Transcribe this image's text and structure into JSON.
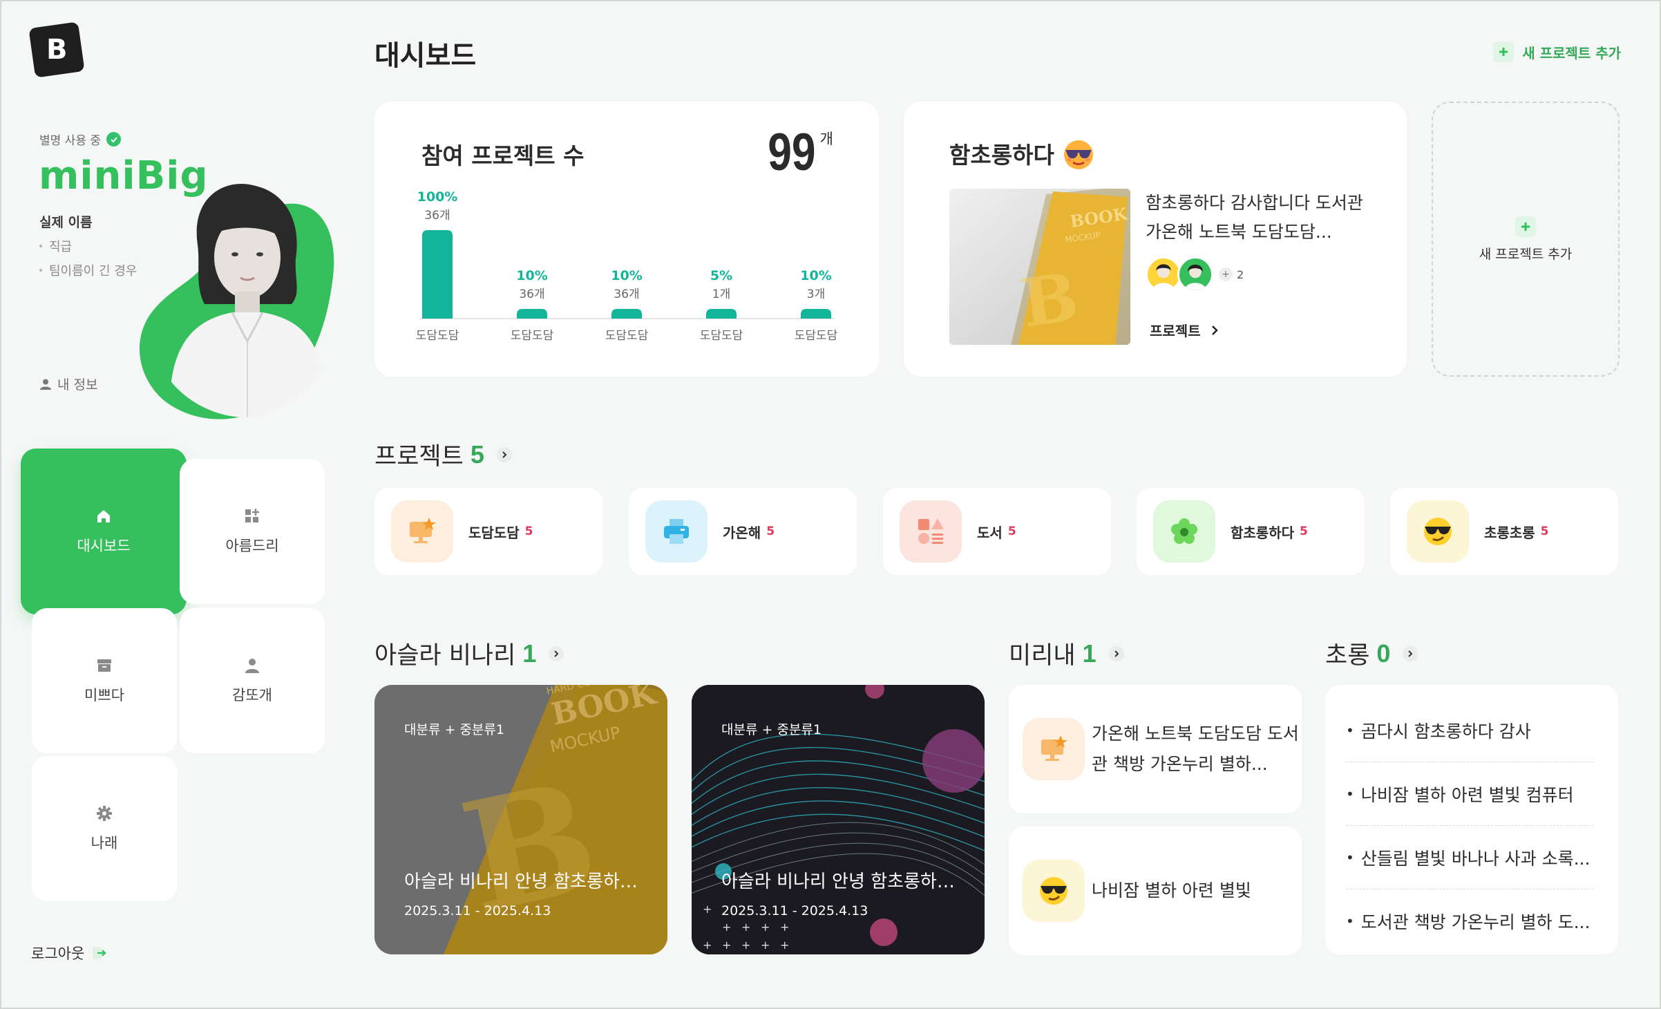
{
  "sidebar": {
    "nick_status": "별명 사용 중",
    "nickname": "miniBig",
    "realname_label": "실제 이름",
    "sub_items": [
      "직급",
      "팀이름이 긴 경우"
    ],
    "my_info": "내 정보",
    "nav": [
      {
        "label": "대시보드",
        "icon": "home-icon",
        "active": true
      },
      {
        "label": "아름드리",
        "icon": "apps-plus-icon",
        "active": false
      },
      {
        "label": "미쁘다",
        "icon": "archive-icon",
        "active": false
      },
      {
        "label": "감또개",
        "icon": "user-icon",
        "active": false
      },
      {
        "label": "나래",
        "icon": "gear-icon",
        "active": false
      }
    ],
    "logout": "로그아웃"
  },
  "header": {
    "title": "대시보드",
    "add_project": "새 프로젝트 추가"
  },
  "summary": {
    "title": "참여 프로젝트 수",
    "total": "99",
    "unit": "개"
  },
  "chart_data": {
    "type": "bar",
    "categories": [
      "도담도담",
      "도담도담",
      "도담도담",
      "도담도담",
      "도담도담"
    ],
    "values": [
      100,
      10,
      10,
      5,
      10
    ],
    "percent_labels": [
      "100%",
      "10%",
      "10%",
      "5%",
      "10%"
    ],
    "count_labels": [
      "36개",
      "36개",
      "36개",
      "1개",
      "3개"
    ],
    "bar_color": "#12b59a"
  },
  "feature": {
    "title": "함초롱하다",
    "title_icon": "sunglasses-emoji-icon",
    "text": "함초롱하다 감사합니다 도서관 가온해 노트북 도담도담...",
    "more_count": "2",
    "link": "프로젝트"
  },
  "add_card": {
    "label": "새 프로젝트 추가"
  },
  "projects": {
    "title": "프로젝트",
    "count": "5",
    "items": [
      {
        "name": "도담도담",
        "count": "5",
        "icon": "monitor-star-icon",
        "bg": "#fdeede"
      },
      {
        "name": "가온해",
        "count": "5",
        "icon": "printer-icon",
        "bg": "#ddf3fb"
      },
      {
        "name": "도서",
        "count": "5",
        "icon": "shapes-icon",
        "bg": "#fde5df"
      },
      {
        "name": "함초롱하다",
        "count": "5",
        "icon": "flower-icon",
        "bg": "#e0f8dc"
      },
      {
        "name": "초롱초롱",
        "count": "5",
        "icon": "sunglasses-emoji-icon",
        "bg": "#fcf5d6"
      }
    ]
  },
  "section_asla": {
    "title": "아슬라 비나리",
    "count": "1",
    "cards": [
      {
        "tag": "대분류 + 중분류1",
        "title": "아슬라 비나리 안녕 함초롱하다...",
        "date": "2025.3.11 - 2025.4.13"
      },
      {
        "tag": "대분류 + 중분류1",
        "title": "아슬라 비나리 안녕 함초롱하다...",
        "date": "2025.3.11 - 2025.4.13"
      }
    ]
  },
  "section_mirinae": {
    "title": "미리내",
    "count": "1",
    "items": [
      {
        "text": "가온해 노트북 도담도담 도서관 책방 가온누리 별하...",
        "icon": "monitor-star-icon"
      },
      {
        "text": "나비잠 별하 아련 별빛",
        "icon": "sunglasses-emoji-icon"
      }
    ]
  },
  "section_chorong": {
    "title": "초롱",
    "count": "0",
    "items": [
      "곰다시 함초롱하다 감사",
      "나비잠 별하 아련 별빛 컴퓨터",
      "산들림 별빛 바나나 사과 소록...",
      "도서관 책방 가온누리 별하 도..."
    ]
  },
  "colors": {
    "accent": "#35c05d",
    "bar": "#12b59a",
    "count_red": "#e2365b"
  }
}
